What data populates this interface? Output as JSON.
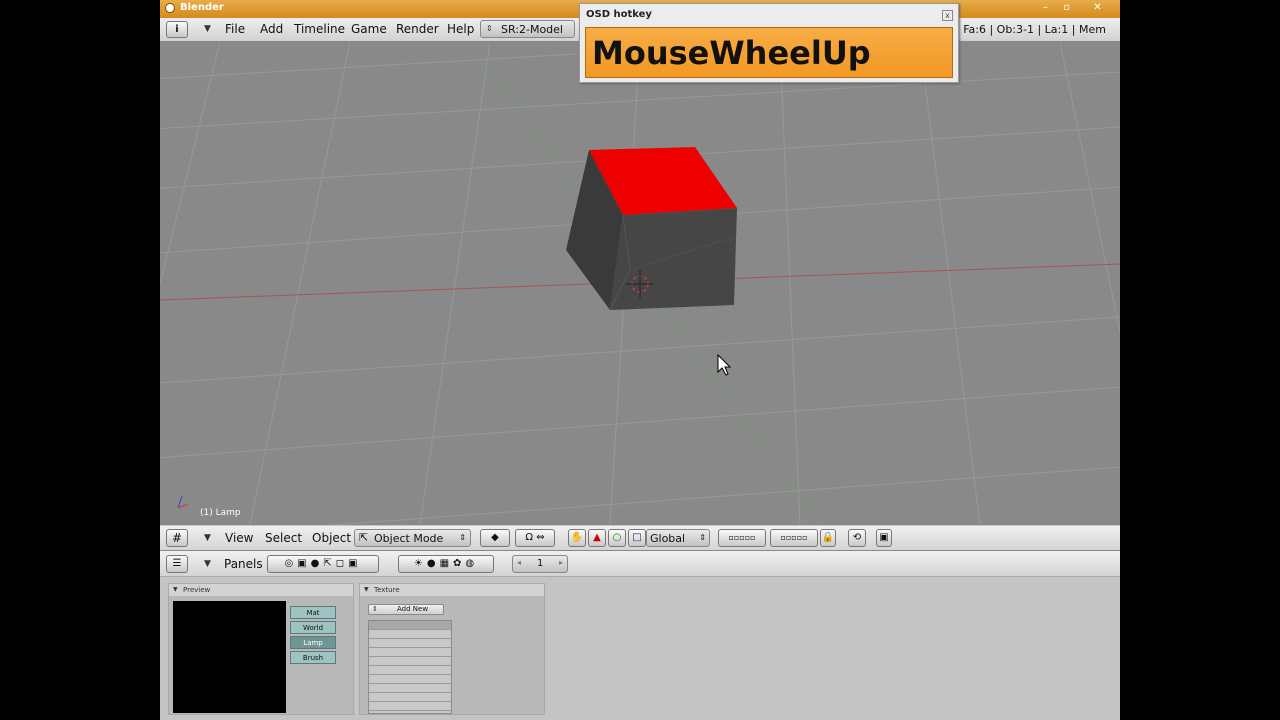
{
  "window": {
    "title": "Blender",
    "controls": [
      "–",
      "▫",
      "✕"
    ]
  },
  "info_header": {
    "menus": [
      "File",
      "Add",
      "Timeline",
      "Game",
      "Render",
      "Help"
    ],
    "screen_selector": "SR:2-Model",
    "stats": "| Fa:6 | Ob:3-1 | La:1 | Mem"
  },
  "osd": {
    "title": "OSD hotkey",
    "close": "x",
    "text": "MouseWheelUp"
  },
  "viewport": {
    "object_label": "(1) Lamp",
    "cube_top_color": "#ee0000",
    "background_color": "#898989"
  },
  "view3d_header": {
    "menus": [
      "View",
      "Select",
      "Object"
    ],
    "mode": "Object Mode",
    "orientation": "Global"
  },
  "buttons_header": {
    "panels_label": "Panels",
    "frame": "1"
  },
  "preview_panel": {
    "title": "Preview",
    "tabs": [
      "Mat",
      "World",
      "Lamp",
      "Brush"
    ],
    "selected_tab": "Lamp"
  },
  "texture_panel": {
    "title": "Texture",
    "add_new": "Add New"
  }
}
